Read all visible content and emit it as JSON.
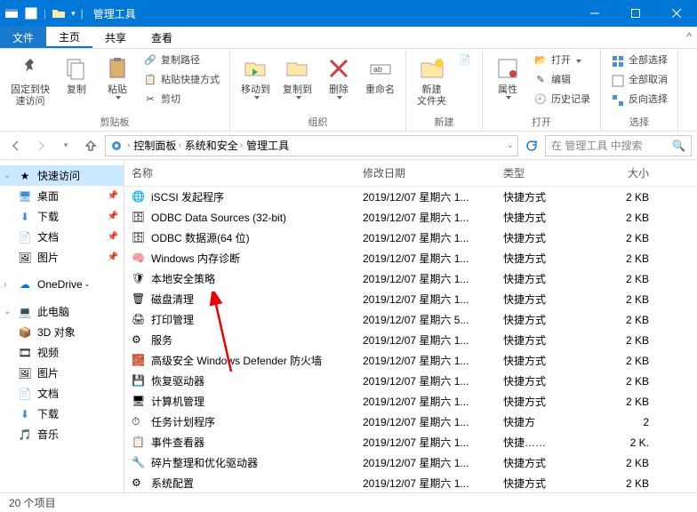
{
  "window": {
    "title": "管理工具"
  },
  "menu": {
    "file": "文件",
    "home": "主页",
    "share": "共享",
    "view": "查看"
  },
  "ribbon": {
    "pin": "固定到快\n速访问",
    "copy": "复制",
    "paste": "粘贴",
    "copypath": "复制路径",
    "pasteshortcut": "粘贴快捷方式",
    "cut": "剪切",
    "group_clipboard": "剪贴板",
    "moveto": "移动到",
    "copyto": "复制到",
    "delete": "删除",
    "rename": "重命名",
    "group_organize": "组织",
    "newfolder": "新建\n文件夹",
    "group_new": "新建",
    "properties": "属性",
    "open": "打开",
    "edit": "编辑",
    "history": "历史记录",
    "group_open": "打开",
    "selectall": "全部选择",
    "selectnone": "全部取消",
    "invert": "反向选择",
    "group_select": "选择"
  },
  "nav": {
    "crumbs": [
      "控制面板",
      "系统和安全",
      "管理工具"
    ],
    "search_placeholder": "在 管理工具 中搜索"
  },
  "sidebar": {
    "quick": "快速访问",
    "desktop": "桌面",
    "downloads": "下载",
    "documents": "文档",
    "pictures": "图片",
    "onedrive": "OneDrive -",
    "thispc": "此电脑",
    "3dobjects": "3D 对象",
    "videos": "视频",
    "pictures2": "图片",
    "documents2": "文档",
    "downloads2": "下载",
    "music": "音乐"
  },
  "columns": {
    "name": "名称",
    "date": "修改日期",
    "type": "类型",
    "size": "大小"
  },
  "files": [
    {
      "name": "iSCSI 发起程序",
      "date": "2019/12/07 星期六 1...",
      "type": "快捷方式",
      "size": "2 KB",
      "icon": "exe"
    },
    {
      "name": "ODBC Data Sources (32-bit)",
      "date": "2019/12/07 星期六 1...",
      "type": "快捷方式",
      "size": "2 KB",
      "icon": "db"
    },
    {
      "name": "ODBC 数据源(64 位)",
      "date": "2019/12/07 星期六 1...",
      "type": "快捷方式",
      "size": "2 KB",
      "icon": "db"
    },
    {
      "name": "Windows 内存诊断",
      "date": "2019/12/07 星期六 1...",
      "type": "快捷方式",
      "size": "2 KB",
      "icon": "mem"
    },
    {
      "name": "本地安全策略",
      "date": "2019/12/07 星期六 1...",
      "type": "快捷方式",
      "size": "2 KB",
      "icon": "sec"
    },
    {
      "name": "磁盘清理",
      "date": "2019/12/07 星期六 1...",
      "type": "快捷方式",
      "size": "2 KB",
      "icon": "disk"
    },
    {
      "name": "打印管理",
      "date": "2019/12/07 星期六 5...",
      "type": "快捷方式",
      "size": "2 KB",
      "icon": "print"
    },
    {
      "name": "服务",
      "date": "2019/12/07 星期六 1...",
      "type": "快捷方式",
      "size": "2 KB",
      "icon": "gear"
    },
    {
      "name": "高级安全 Windows Defender 防火墙",
      "date": "2019/12/07 星期六 1...",
      "type": "快捷方式",
      "size": "2 KB",
      "icon": "fw"
    },
    {
      "name": "恢复驱动器",
      "date": "2019/12/07 星期六 1...",
      "type": "快捷方式",
      "size": "2 KB",
      "icon": "rec"
    },
    {
      "name": "计算机管理",
      "date": "2019/12/07 星期六 1...",
      "type": "快捷方式",
      "size": "2 KB",
      "icon": "comp"
    },
    {
      "name": "任务计划程序",
      "date": "2019/12/07 星期六 1...",
      "type": "快捷方 ",
      "size": "2  ",
      "icon": "task"
    },
    {
      "name": "事件查看器",
      "date": "2019/12/07 星期六 1...",
      "type": "快捷……",
      "size": "2 K.",
      "icon": "event"
    },
    {
      "name": "碎片整理和优化驱动器",
      "date": "2019/12/07 星期六 1...",
      "type": "快捷方式",
      "size": "2 KB",
      "icon": "defrag"
    },
    {
      "name": "系统配置",
      "date": "2019/12/07 星期六 1...",
      "type": "快捷方式",
      "size": "2 KB",
      "icon": "sys"
    }
  ],
  "status": {
    "count": "20 个项目"
  }
}
